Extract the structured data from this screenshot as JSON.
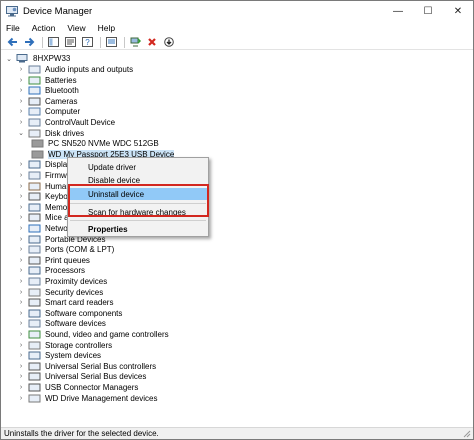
{
  "window": {
    "title": "Device Manager",
    "minimize": "—",
    "maximize": "☐",
    "close": "✕"
  },
  "menu": [
    "File",
    "Action",
    "View",
    "Help"
  ],
  "toolbar": {
    "icons": [
      "back-arrow-icon",
      "forward-arrow-icon",
      "show-hide-tree-icon",
      "properties-icon",
      "help-icon",
      "update-driver-icon",
      "scan-hardware-icon",
      "remove-device-icon",
      "download-arrow-icon"
    ]
  },
  "tree": {
    "root": "8HXPW33",
    "items": [
      {
        "label": "Audio inputs and outputs",
        "expander": "›"
      },
      {
        "label": "Batteries",
        "expander": "›"
      },
      {
        "label": "Bluetooth",
        "expander": "›"
      },
      {
        "label": "Cameras",
        "expander": "›"
      },
      {
        "label": "Computer",
        "expander": "›"
      },
      {
        "label": "ControlVault Device",
        "expander": "›"
      },
      {
        "label": "Disk drives",
        "expander": "⌄"
      },
      {
        "label": "PC SN520 NVMe WDC 512GB",
        "expander": ""
      },
      {
        "label": "WD My Passport 25E3 USB Device",
        "expander": ""
      },
      {
        "label": "Display a",
        "expander": "›"
      },
      {
        "label": "Firmwar",
        "expander": "›"
      },
      {
        "label": "Human",
        "expander": "›"
      },
      {
        "label": "Keyboa",
        "expander": "›"
      },
      {
        "label": "Memor",
        "expander": "›"
      },
      {
        "label": "Mice an",
        "expander": "›"
      },
      {
        "label": "Network adapters",
        "expander": "›"
      },
      {
        "label": "Portable Devices",
        "expander": "›"
      },
      {
        "label": "Ports (COM & LPT)",
        "expander": "›"
      },
      {
        "label": "Print queues",
        "expander": "›"
      },
      {
        "label": "Processors",
        "expander": "›"
      },
      {
        "label": "Proximity devices",
        "expander": "›"
      },
      {
        "label": "Security devices",
        "expander": "›"
      },
      {
        "label": "Smart card readers",
        "expander": "›"
      },
      {
        "label": "Software components",
        "expander": "›"
      },
      {
        "label": "Software devices",
        "expander": "›"
      },
      {
        "label": "Sound, video and game controllers",
        "expander": "›"
      },
      {
        "label": "Storage controllers",
        "expander": "›"
      },
      {
        "label": "System devices",
        "expander": "›"
      },
      {
        "label": "Universal Serial Bus controllers",
        "expander": "›"
      },
      {
        "label": "Universal Serial Bus devices",
        "expander": "›"
      },
      {
        "label": "USB Connector Managers",
        "expander": "›"
      },
      {
        "label": "WD Drive Management devices",
        "expander": "›"
      }
    ]
  },
  "context_menu": {
    "items": [
      "Update driver",
      "Disable device",
      "Uninstall device",
      "Scan for hardware changes",
      "Properties"
    ]
  },
  "statusbar": {
    "text": "Uninstalls the driver for the selected device."
  },
  "colors": {
    "highlight": "#91c9f7",
    "selection": "#cce4f7",
    "annotation_box": "#d2271f"
  }
}
